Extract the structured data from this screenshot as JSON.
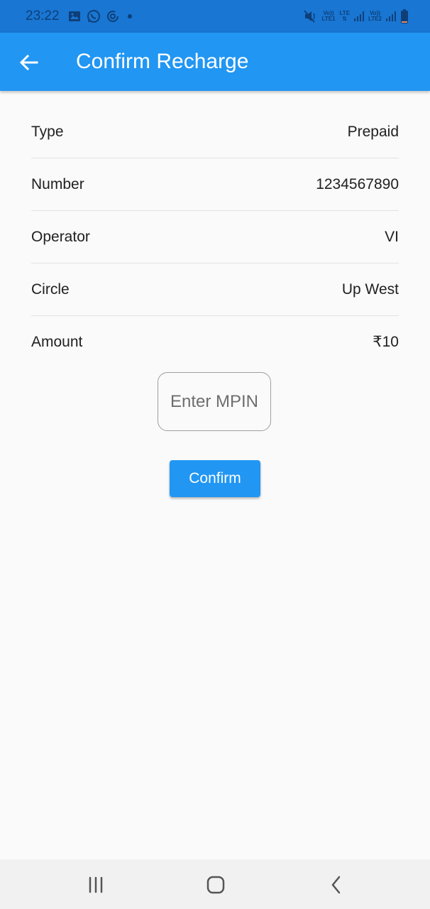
{
  "status_bar": {
    "time": "23:22",
    "left_icons": [
      "gallery-icon",
      "whatsapp-icon",
      "sync-icon",
      "dot-icon"
    ],
    "right_icons": [
      "mute-icon",
      "volte-lte1-icon",
      "lte-icon",
      "signal-icon",
      "volte-lte2-icon",
      "signal-icon",
      "battery-icon"
    ],
    "sim1_label_top": "Vo))",
    "sim1_label_bottom": "LTE1",
    "lte_label": "LTE",
    "sim2_label_top": "Vo))",
    "sim2_label_bottom": "LTE2"
  },
  "app_bar": {
    "title": "Confirm Recharge",
    "back_icon": "arrow-left-icon",
    "background": "#2196f3"
  },
  "details": [
    {
      "label": "Type",
      "value": "Prepaid"
    },
    {
      "label": "Number",
      "value": "1234567890"
    },
    {
      "label": "Operator",
      "value": "VI"
    },
    {
      "label": "Circle",
      "value": "Up West"
    },
    {
      "label": "Amount",
      "value": "₹10"
    }
  ],
  "mpin_input": {
    "placeholder": "Enter MPIN",
    "value": ""
  },
  "confirm_button": {
    "label": "Confirm",
    "color": "#2196f3"
  },
  "nav_bar": {
    "recents_icon": "recents-icon",
    "home_icon": "home-icon",
    "back_icon": "back-icon"
  }
}
